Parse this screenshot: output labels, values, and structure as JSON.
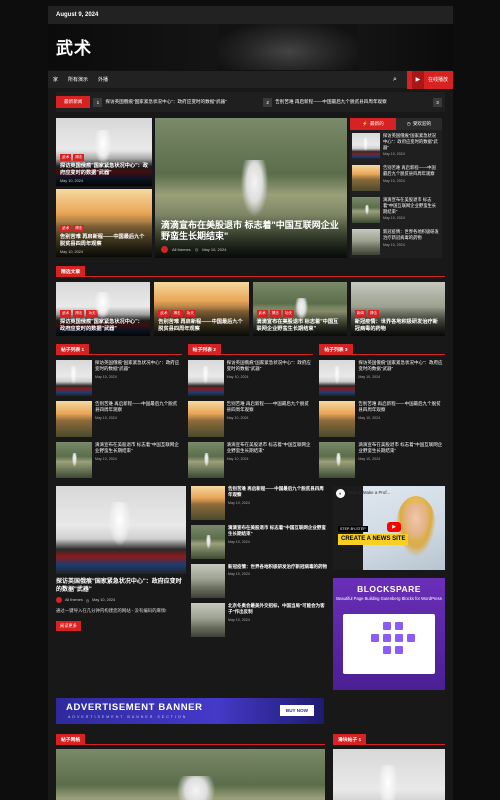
{
  "topbar": {
    "date": "August 9, 2024"
  },
  "site": {
    "title": "武术"
  },
  "nav": {
    "items": [
      "家",
      "所有演示",
      "外播"
    ],
    "live_label": "在线播放"
  },
  "ticker": {
    "label": "最新新闻",
    "items": [
      {
        "num": "1",
        "text": "探访英国俄痕\"国家紧急状况中心\"：政府应变时的数据\"武器\""
      },
      {
        "num": "2",
        "text": "告别苦难 再启新程——中国最后九个脱贫县四周年观察"
      },
      {
        "num": "3",
        "text": ""
      }
    ]
  },
  "hero": {
    "left_cards": [
      {
        "tags": [
          "武术",
          "搏击"
        ],
        "title": "探访英国俄痕\"国家紧急状况中心\"：政府应变时的数据\"武器\"",
        "date": "May 10, 2024"
      },
      {
        "tags": [
          "武术",
          "搏击"
        ],
        "title": "告别苦难 再启新程——中国最后九个脱贫县四周年观察",
        "date": "May 10, 2024"
      }
    ],
    "center": {
      "title": "滴滴宣布在美股退市 标志着\"中国互联网企业野蛮生长期结束\"",
      "author": "All themes",
      "date": "May 10, 2024"
    },
    "right": {
      "tab_latest": "最新的",
      "tab_popular": "受欢迎的",
      "items": [
        {
          "title": "探访英国俄痕\"国家紧急状况中心\"：政府应变时的数据\"武器\"",
          "date": "May 10, 2024"
        },
        {
          "title": "告别苦难 再启新程——中国最后九个脱贫县四周年观察",
          "date": "May 10, 2024"
        },
        {
          "title": "滴滴宣布在美股退市 标志着\"中国互联网企业野蛮生长期结束\"",
          "date": "May 10, 2024"
        },
        {
          "title": "新冠疫情：世界各地积极研发治疗新冠病毒的药物",
          "date": "May 10, 2024"
        }
      ]
    }
  },
  "featured": {
    "heading": "精选文章",
    "cards": [
      {
        "tags": [
          "武术",
          "搏击",
          "功夫"
        ],
        "title": "探访英国俄痕\"国家紧急状况中心\"：政府应变时的数据\"武器\"",
        "date": "May 10, 2024"
      },
      {
        "tags": [
          "武术",
          "搏击",
          "功夫"
        ],
        "title": "告别苦难 再启新程——中国最后九个脱贫县四周年观察",
        "date": "May 10, 2024"
      },
      {
        "tags": [
          "武术",
          "搏击",
          "功夫"
        ],
        "title": "滴滴宣布在美股退市 标志着\"中国互联网企业野蛮生长期结束\"",
        "date": "May 10, 2024"
      },
      {
        "tags": [
          "新闻",
          "搏击"
        ],
        "title": "新冠疫情：世界各地积极研发治疗新冠病毒的药物",
        "date": "May 10, 2024"
      }
    ]
  },
  "lists": [
    {
      "heading": "帖子列表 1",
      "items": [
        {
          "title": "探访英国俄痕\"国家紧急状况中心\"：政府应变时的数据\"武器\"",
          "date": "May 10, 2024"
        },
        {
          "title": "告别苦难 再启新程——中国最后九个脱贫县四周年观察",
          "date": "May 10, 2024"
        },
        {
          "title": "滴滴宣布在美股退市 标志着\"中国互联网企业野蛮生长期结束\"",
          "date": "May 10, 2024"
        }
      ]
    },
    {
      "heading": "帖子列表 2",
      "items": [
        {
          "title": "探访英国俄痕\"国家紧急状况中心\"：政府应变时的数据\"武器\"",
          "date": "May 10, 2024"
        },
        {
          "title": "告别苦难 再启新程——中国最后九个脱贫县四周年观察",
          "date": "May 10, 2024"
        },
        {
          "title": "滴滴宣布在美股退市 标志着\"中国互联网企业野蛮生长期结束\"",
          "date": "May 10, 2024"
        }
      ]
    },
    {
      "heading": "帖子列表 3",
      "items": [
        {
          "title": "探访英国俄痕\"国家紧急状况中心\"：政府应变时的数据\"武器\"",
          "date": "May 10, 2024"
        },
        {
          "title": "告别苦难 再启新程——中国最后九个脱贫县四周年观察",
          "date": "May 10, 2024"
        },
        {
          "title": "滴滴宣布在美股退市 标志着\"中国互联网企业野蛮生长期结束\"",
          "date": "May 10, 2024"
        }
      ]
    }
  ],
  "band": {
    "feature": {
      "title": "探访英国俄痕\"国家紧急状况中心\"：政府应变时的数据\"武器\"",
      "author": "All themes",
      "date": "May 10, 2024",
      "excerpt": "通过一键导入在几分钟内构建您的网站 - 没有编码的麻烦!",
      "read_more": "阅读更多"
    },
    "mid": [
      {
        "title": "告别苦难 再启新程——中国最后九个脱贫县四周年观察",
        "date": "May 10, 2024"
      },
      {
        "title": "滴滴宣布在美股退市 标志着\"中国互联网企业野蛮生长期结束\"",
        "date": "May 10, 2024"
      },
      {
        "title": "新冠疫情：世界各地积极研发治疗新冠病毒的药物",
        "date": "May 10, 2024"
      },
      {
        "title": "北京冬奥会最美外交招标，中国当局\"可能会为客子\"作出反制",
        "date": "May 10, 2024"
      }
    ],
    "promo": {
      "how": "How to Make a Prof...",
      "steps": "STEP-BY-STEP",
      "cta": "CREATE A NEWS SITE"
    },
    "blockspare": {
      "title": "BLOCKSPARE",
      "subtitle": "Beautiful Page Building Gutenberg Blocks for WordPress"
    }
  },
  "ad": {
    "title": "ADVERTISEMENT BANNER",
    "subtitle": "ADVERTISEMENT BANNER SECTION",
    "button": "BUY NOW"
  },
  "bottom": {
    "left_heading": "帖子网格",
    "right_heading": "滑块帖子 1"
  }
}
